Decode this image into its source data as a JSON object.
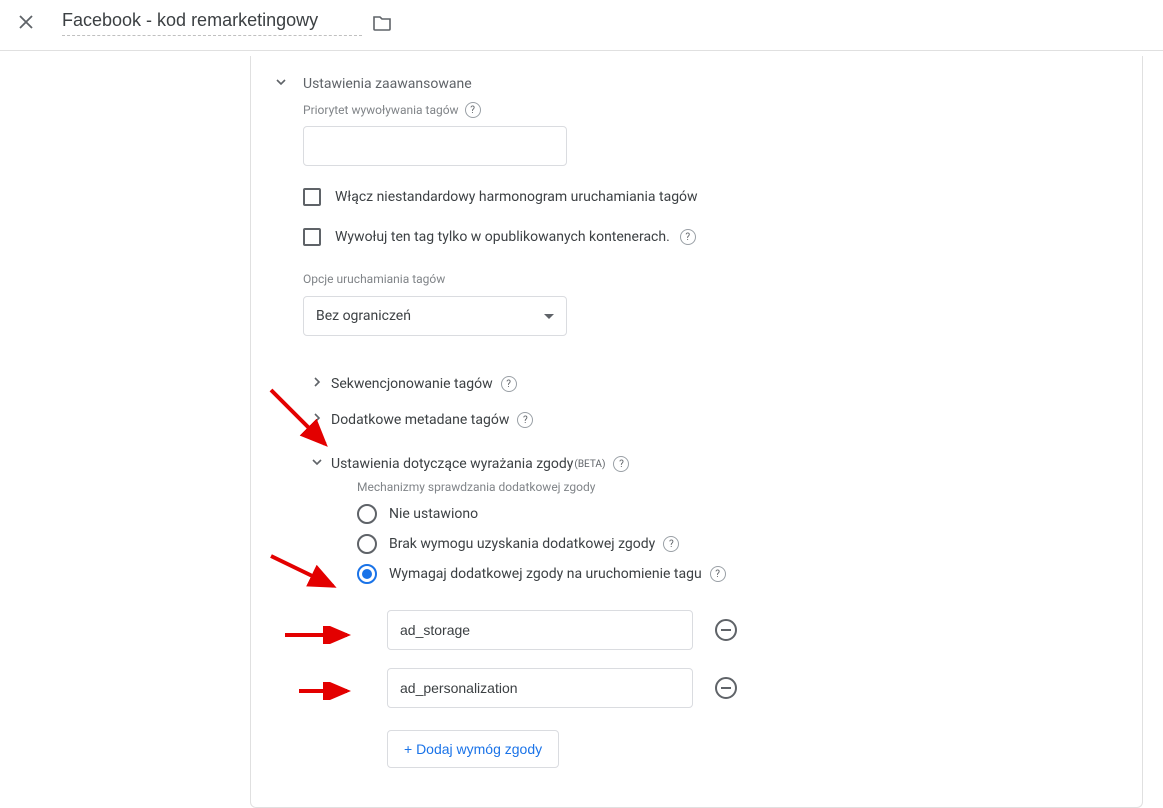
{
  "header": {
    "title": "Facebook - kod remarketingowy"
  },
  "advanced": {
    "heading": "Ustawienia zaawansowane",
    "priority_label": "Priorytet wywoływania tagów",
    "priority_value": "",
    "checkbox1": "Włącz niestandardowy harmonogram uruchamiania tagów",
    "checkbox2": "Wywołuj ten tag tylko w opublikowanych kontenerach.",
    "options_label": "Opcje uruchamiania tagów",
    "options_value": "Bez ograniczeń"
  },
  "collapsed": {
    "sequencing": "Sekwencjonowanie tagów",
    "metadata": "Dodatkowe metadane tagów"
  },
  "consent": {
    "heading": "Ustawienia dotyczące wyrażania zgody",
    "beta": "(BETA)",
    "subtitle": "Mechanizmy sprawdzania dodatkowej zgody",
    "radio1": "Nie ustawiono",
    "radio2": "Brak wymogu uzyskania dodatkowej zgody",
    "radio3": "Wymagaj dodatkowej zgody na uruchomienie tagu",
    "chips": [
      "ad_storage",
      "ad_personalization"
    ],
    "add_button": "+ Dodaj wymóg zgody"
  }
}
